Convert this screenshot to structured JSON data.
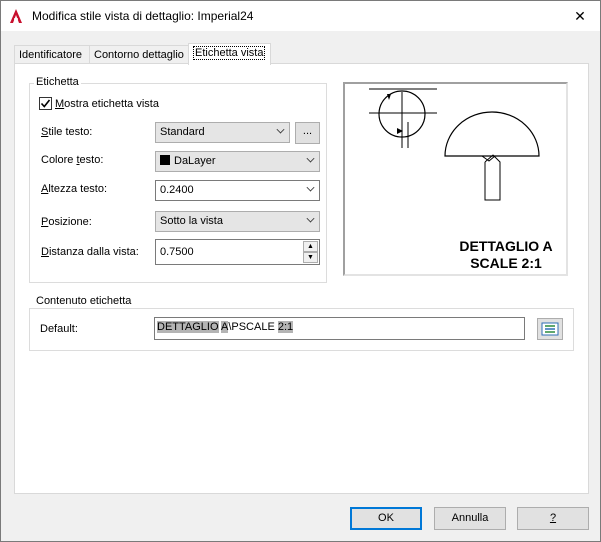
{
  "window": {
    "title": "Modifica stile vista di dettaglio: Imperial24",
    "close_glyph": "✕"
  },
  "tabs": [
    {
      "label": "Identificatore"
    },
    {
      "label": "Contorno dettaglio"
    },
    {
      "label": "Etichetta vista",
      "active": true
    }
  ],
  "etichetta": {
    "legend": "Etichetta",
    "show_label": {
      "label_rest": "ostra etichetta vista",
      "label_u": "M",
      "checked": true
    },
    "stile_testo": {
      "label_u": "S",
      "label_rest": "tile testo:",
      "value": "Standard",
      "browse": "..."
    },
    "colore_testo": {
      "label_a": "Colore ",
      "label_u": "t",
      "label_b": "esto:",
      "value": "DaLayer"
    },
    "altezza_testo": {
      "label_u": "A",
      "label_rest": "ltezza testo:",
      "value": "0.2400"
    },
    "posizione": {
      "label_u": "P",
      "label_rest": "osizione:",
      "value": "Sotto la vista"
    },
    "distanza": {
      "label_u": "D",
      "label_rest": "istanza dalla vista:",
      "value": "0.7500"
    }
  },
  "preview": {
    "line1": "DETTAGLIO A",
    "line2": "SCALE 2:1"
  },
  "contenuto": {
    "legend": "Contenuto etichetta",
    "default_label": "Default:",
    "default_value_parts": [
      "DETTAGLIO",
      " ",
      "A",
      "\\PSCALE ",
      "2:1"
    ]
  },
  "buttons": {
    "ok": "OK",
    "annulla": "Annulla",
    "help": "?"
  },
  "colors": {
    "accent": "#0078d7",
    "app_icon": "#c8102e"
  }
}
